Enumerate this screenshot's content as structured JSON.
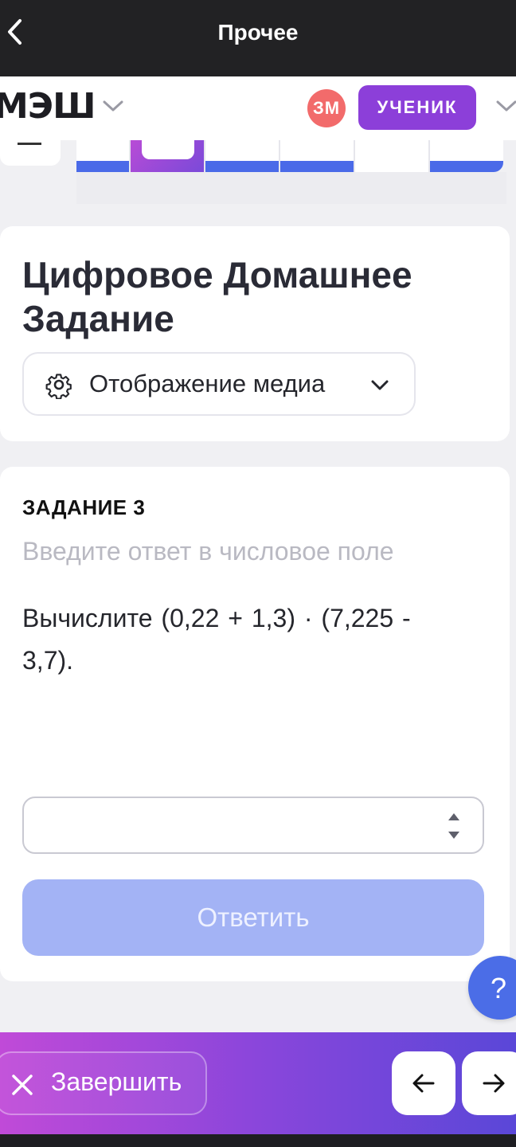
{
  "topbar": {
    "title": "Прочее",
    "back_icon": "chevron-left-icon"
  },
  "header": {
    "logo": "МЭШ",
    "logo_menu_icon": "chevron-down-icon",
    "avatar_initials": "ЗМ",
    "role_button_label": "УЧЕНИК",
    "role_menu_icon": "chevron-down-icon"
  },
  "task_nav": {
    "active_index": 2,
    "cells": [
      {
        "state": "answered"
      },
      {
        "state": "active"
      },
      {
        "state": "answered"
      },
      {
        "state": "answered"
      },
      {
        "state": "empty"
      },
      {
        "state": "answered"
      }
    ]
  },
  "page": {
    "title": "Цифровое Домашнее Задание",
    "media_select": {
      "label": "Отображение медиа",
      "icon": "gear-icon",
      "chevron": "chevron-down-icon"
    }
  },
  "task": {
    "label": "ЗАДАНИЕ 3",
    "hint": "Введите ответ в числовое поле",
    "question": "Вычислите (0,22 + 1,3)   ·   (7,225 - 3,7).",
    "answer_value": "",
    "answer_placeholder": "",
    "submit_label": "Ответить"
  },
  "help": {
    "label": "?"
  },
  "bottombar": {
    "finish_label": "Завершить",
    "finish_icon": "close-icon",
    "prev_icon": "arrow-left-icon",
    "next_icon": "arrow-right-icon"
  },
  "colors": {
    "topbar_bg": "#222224",
    "role_button": "#8c3fd9",
    "avatar": "#f26b6b",
    "accent_blue": "#4a6ae8",
    "submit_disabled": "#a3b3f5",
    "bottombar_gradient_start": "#c04ad8",
    "bottombar_gradient_end": "#5a47d8"
  }
}
